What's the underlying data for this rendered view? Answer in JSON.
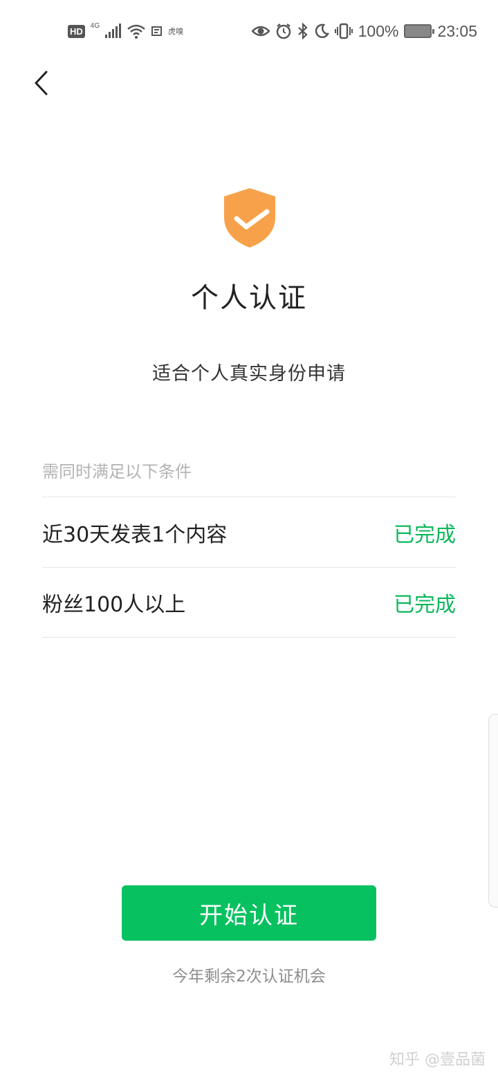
{
  "status_bar": {
    "hd": "HD",
    "network": "4G",
    "carrier_text": "虎嗅",
    "battery_percent": "100%",
    "time": "23:05"
  },
  "header": {
    "back_icon": "chevron-left-icon"
  },
  "hero": {
    "icon": "shield-check-icon",
    "icon_color": "#f7a24a",
    "title": "个人认证",
    "subtitle": "适合个人真实身份申请"
  },
  "conditions": {
    "header": "需同时满足以下条件",
    "items": [
      {
        "label": "近30天发表1个内容",
        "status": "已完成"
      },
      {
        "label": "粉丝100人以上",
        "status": "已完成"
      }
    ],
    "status_color": "#0bb85a"
  },
  "action": {
    "button_label": "开始认证",
    "button_color": "#07c160",
    "remaining_text": "今年剩余2次认证机会"
  },
  "watermark": "知乎 @壹品菌"
}
